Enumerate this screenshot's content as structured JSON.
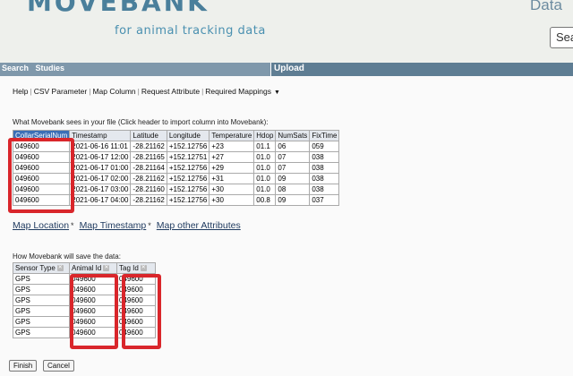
{
  "header": {
    "logo_text": "MOVEBANK",
    "tagline": "for animal tracking data",
    "data_link": "Data",
    "search_value": "Sea"
  },
  "nav": {
    "items": [
      "Search",
      "Studies"
    ],
    "upload": "Upload"
  },
  "menu": {
    "items": [
      "Help",
      "CSV Parameter",
      "Map Column",
      "Request Attribute",
      "Required Mappings"
    ]
  },
  "file_section": {
    "label": "What Movebank sees in your file (Click header to import column into Movebank):",
    "columns": [
      "CollarSerialNum",
      "Timestamp",
      "Latitude",
      "Longitude",
      "Temperature",
      "Hdop",
      "NumSats",
      "FixTime"
    ],
    "rows": [
      [
        "049600",
        "2021-06-16 11:01",
        "-28.21162",
        "+152.12756",
        "+23",
        "01.1",
        "06",
        "059"
      ],
      [
        "049600",
        "2021-06-17 12:00",
        "-28.21165",
        "+152.12751",
        "+27",
        "01.0",
        "07",
        "038"
      ],
      [
        "049600",
        "2021-06-17 01:00",
        "-28.21164",
        "+152.12756",
        "+29",
        "01.0",
        "07",
        "038"
      ],
      [
        "049600",
        "2021-06-17 02:00",
        "-28.21162",
        "+152.12756",
        "+31",
        "01.0",
        "09",
        "038"
      ],
      [
        "049600",
        "2021-06-17 03:00",
        "-28.21160",
        "+152.12756",
        "+30",
        "01.0",
        "08",
        "038"
      ],
      [
        "049600",
        "2021-06-17 04:00",
        "-28.21162",
        "+152.12756",
        "+30",
        "00.8",
        "09",
        "037"
      ]
    ]
  },
  "map_links": {
    "location": "Map Location",
    "timestamp": "Map Timestamp",
    "other": "Map other Attributes",
    "star": "*"
  },
  "save_section": {
    "label": "How Movebank will save the data:",
    "columns": [
      "Sensor Type",
      "Animal Id",
      "Tag Id"
    ],
    "rows": [
      [
        "GPS",
        "049600",
        "049600"
      ],
      [
        "GPS",
        "049600",
        "049600"
      ],
      [
        "GPS",
        "049600",
        "049600"
      ],
      [
        "GPS",
        "049600",
        "049600"
      ],
      [
        "GPS",
        "049600",
        "049600"
      ],
      [
        "GPS",
        "049600",
        "049600"
      ]
    ]
  },
  "buttons": {
    "finish": "Finish",
    "cancel": "Cancel"
  },
  "colors": {
    "highlight": "#d9262b",
    "nav": "#7f98ab",
    "selected_header": "#3b6fb6"
  }
}
